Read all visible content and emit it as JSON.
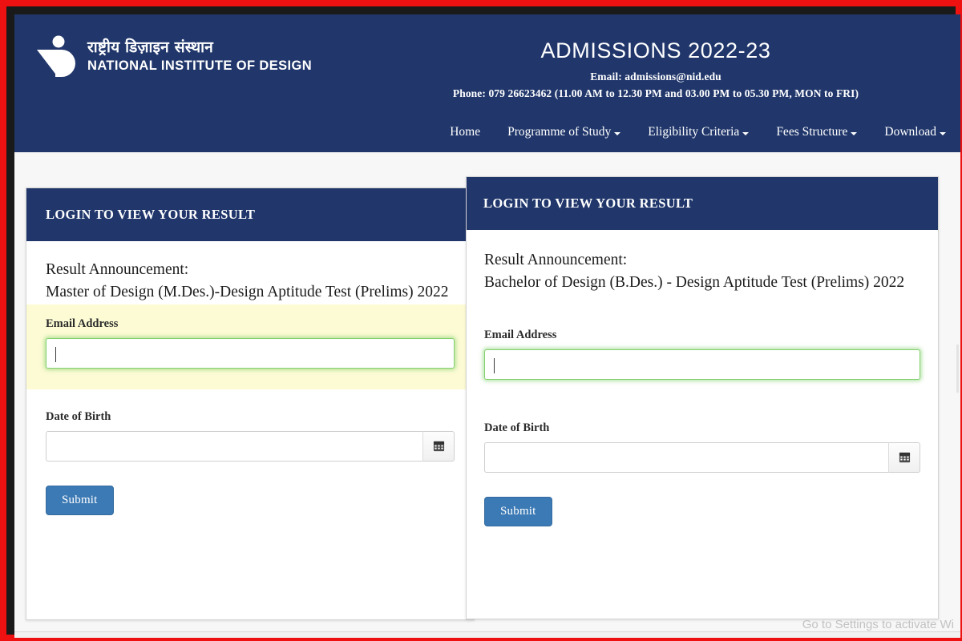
{
  "header": {
    "logo_icon": "nid-logo-icon",
    "brand_hindi": "राष्ट्रीय डिज़ाइन संस्थान",
    "brand_english": "NATIONAL INSTITUTE OF DESIGN",
    "title": "ADMISSIONS 2022-23",
    "email_line": "Email: admissions@nid.edu",
    "phone_line": "Phone: 079 26623462 (11.00 AM to 12.30 PM and 03.00 PM to 05.30 PM, MON to FRI)",
    "bg_color": "#21376b",
    "nav": [
      {
        "label": "Home",
        "has_dropdown": false
      },
      {
        "label": "Programme of Study",
        "has_dropdown": true
      },
      {
        "label": "Eligibility Criteria",
        "has_dropdown": true
      },
      {
        "label": "Fees Structure",
        "has_dropdown": true
      },
      {
        "label": "Download",
        "has_dropdown": true
      }
    ]
  },
  "panels": {
    "mdes": {
      "head_title": "LOGIN TO VIEW YOUR RESULT",
      "announce_label": "Result Announcement:",
      "announce_text": "Master of Design (M.Des.)-Design Aptitude Test (Prelims) 2022",
      "email_label": "Email Address",
      "email_value": "",
      "email_placeholder": "",
      "dob_label": "Date of Birth",
      "dob_value": "",
      "dob_placeholder": "",
      "calendar_icon": "calendar-icon",
      "submit_label": "Submit",
      "autofill_highlight_color": "#fcfbd4",
      "focus_ring_color": "#82d06e"
    },
    "bdes": {
      "head_title": "LOGIN TO VIEW YOUR RESULT",
      "announce_label": "Result Announcement:",
      "announce_text": "Bachelor of Design (B.Des.) - Design Aptitude Test (Prelims) 2022",
      "email_label": "Email Address",
      "email_value": "",
      "email_placeholder": "",
      "dob_label": "Date of Birth",
      "dob_value": "",
      "dob_placeholder": "",
      "calendar_icon": "calendar-icon",
      "submit_label": "Submit",
      "focus_ring_color": "#82d06e"
    }
  },
  "overlay": {
    "watermark": "Go to Settings to activate Wi"
  },
  "colors": {
    "navy": "#21376b",
    "submit_blue": "#3c7ab5",
    "page_bg": "#f7f7f7",
    "frame_red": "#ee1111"
  }
}
